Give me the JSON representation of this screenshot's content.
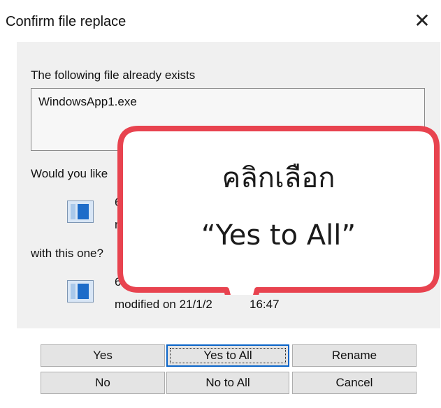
{
  "dialog": {
    "title": "Confirm file replace",
    "close_icon": "close-icon"
  },
  "content": {
    "exists_label": "The following file already exists",
    "file_name": "WindowsApp1.exe",
    "question_partial": "Would you like",
    "existing_file_line1": "6",
    "existing_file_line2": "m",
    "with_this_one": "with this one?",
    "new_file_line1": "6",
    "new_file_modified": "modified on 21/1/2",
    "new_file_time": "16:47"
  },
  "buttons": {
    "yes": "Yes",
    "yes_to_all": "Yes to All",
    "rename": "Rename",
    "no": "No",
    "no_to_all": "No to All",
    "cancel": "Cancel"
  },
  "callout": {
    "line1": "คลิกเลือก",
    "line2": "“Yes to All”",
    "border_color": "#e8434f",
    "fill_color": "#ffffff"
  }
}
